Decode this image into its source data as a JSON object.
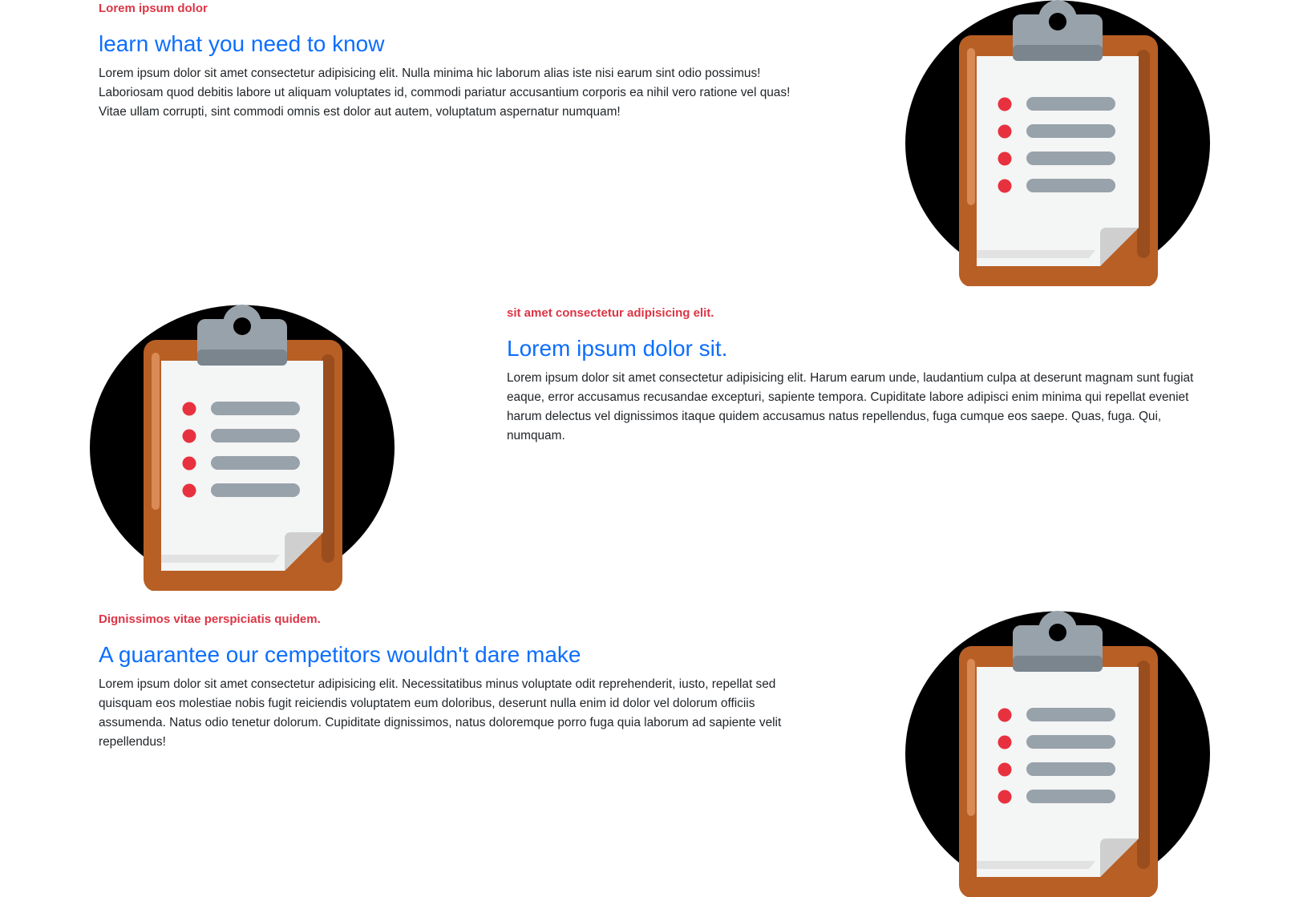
{
  "features": [
    {
      "eyebrow": "Lorem ipsum dolor",
      "heading": "learn what you need to know",
      "body": "Lorem ipsum dolor sit amet consectetur adipisicing elit. Nulla minima hic laborum alias iste nisi earum sint odio possimus! Laboriosam quod debitis labore ut aliquam voluptates id, commodi pariatur accusantium corporis ea nihil vero ratione vel quas! Vitae ullam corrupti, sint commodi omnis est dolor aut autem, voluptatum aspernatur numquam!",
      "image_icon": "clipboard-checklist-icon"
    },
    {
      "eyebrow": "sit amet consectetur adipisicing elit.",
      "heading": "Lorem ipsum dolor sit.",
      "body": "Lorem ipsum dolor sit amet consectetur adipisicing elit. Harum earum unde, laudantium culpa at deserunt magnam sunt fugiat eaque, error accusamus recusandae excepturi, sapiente tempora. Cupiditate labore adipisci enim minima qui repellat eveniet harum delectus vel dignissimos itaque quidem accusamus natus repellendus, fuga cumque eos saepe. Quas, fuga. Qui, numquam.",
      "image_icon": "clipboard-checklist-icon"
    },
    {
      "eyebrow": "Dignissimos vitae perspiciatis quidem.",
      "heading": "A guarantee our cempetitors wouldn't dare make",
      "body": "Lorem ipsum dolor sit amet consectetur adipisicing elit. Necessitatibus minus voluptate odit reprehenderit, iusto, repellat sed quisquam eos molestiae nobis fugit reiciendis voluptatem eum doloribus, deserunt nulla enim id dolor vel dolorum officiis assumenda. Natus odio tenetur dolorum. Cupiditate dignissimos, natus doloremque porro fuga quia laborum ad sapiente velit repellendus!",
      "image_icon": "clipboard-checklist-icon"
    }
  ],
  "colors": {
    "eyebrow": "#dc3545",
    "heading": "#0d6efd",
    "body": "#212529",
    "circle": "#000000",
    "board": "#b85f25",
    "paper": "#f4f5f5",
    "clip": "#98a2aa",
    "bullet": "#e8313f",
    "line": "#98a2aa"
  }
}
